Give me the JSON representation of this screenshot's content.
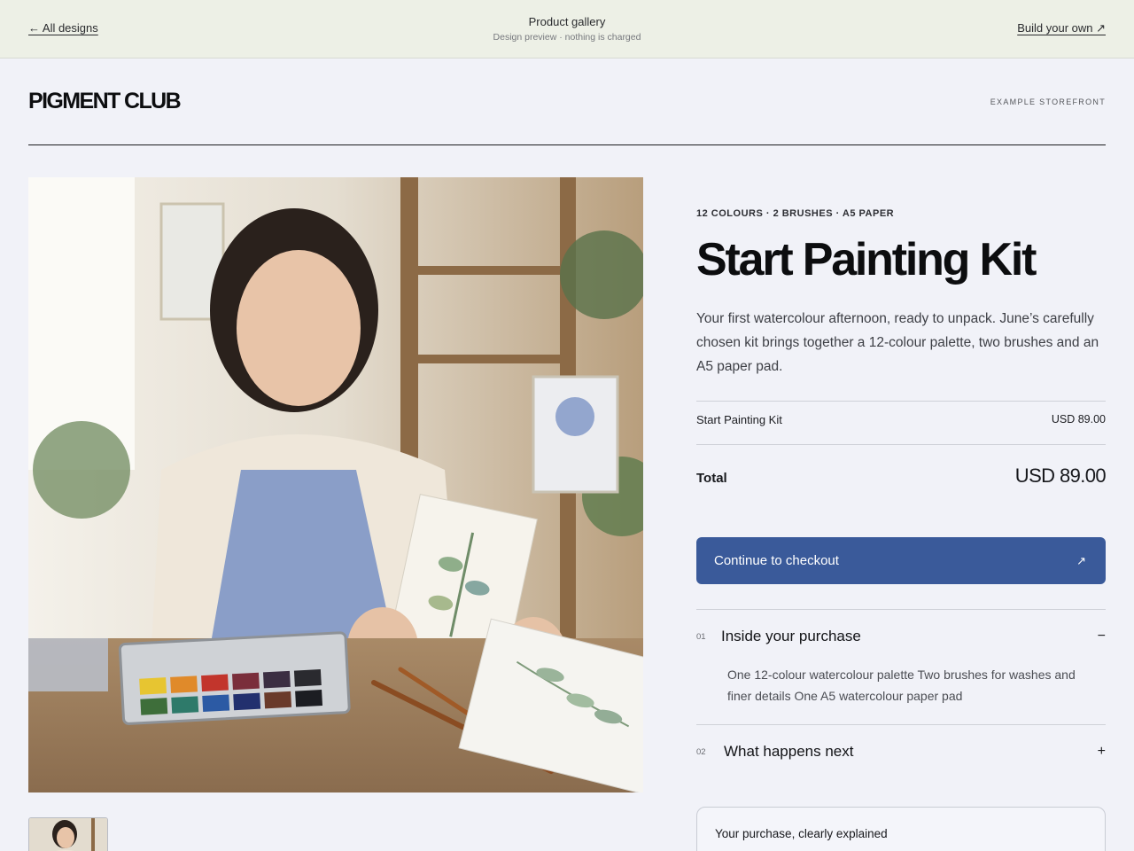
{
  "topbar": {
    "back_label": "← All designs",
    "title": "Product gallery",
    "subtitle": "Design preview · nothing is charged",
    "build_label": "Build your own ↗"
  },
  "header": {
    "brand": "PIGMENT CLUB",
    "label": "EXAMPLE STOREFRONT"
  },
  "product": {
    "meta": "12 COLOURS · 2 BRUSHES · A5 PAPER",
    "title": "Start Painting Kit",
    "description": "Your first watercolour afternoon, ready to unpack. June’s carefully chosen kit brings together a 12-colour palette, two brushes and an A5 paper pad."
  },
  "summary": {
    "item_name": "Start Painting Kit",
    "item_price": "USD 89.00",
    "total_label": "Total",
    "total_amount": "USD 89.00"
  },
  "checkout": {
    "label": "Continue to checkout",
    "icon": "arrow-up-right-icon"
  },
  "accordion": [
    {
      "number": "01",
      "title": "Inside your purchase",
      "toggle": "−",
      "expanded": true,
      "body": "One 12-colour watercolour palette Two brushes for washes and finer details One A5 watercolour paper pad"
    },
    {
      "number": "02",
      "title": "What happens next",
      "toggle": "+",
      "expanded": false
    }
  ],
  "explain_card": {
    "title": "Your purchase, clearly explained"
  },
  "colors": {
    "accent": "#3a5a9a",
    "topbar_bg": "#edf0e6",
    "page_bg": "#f1f2f8"
  }
}
